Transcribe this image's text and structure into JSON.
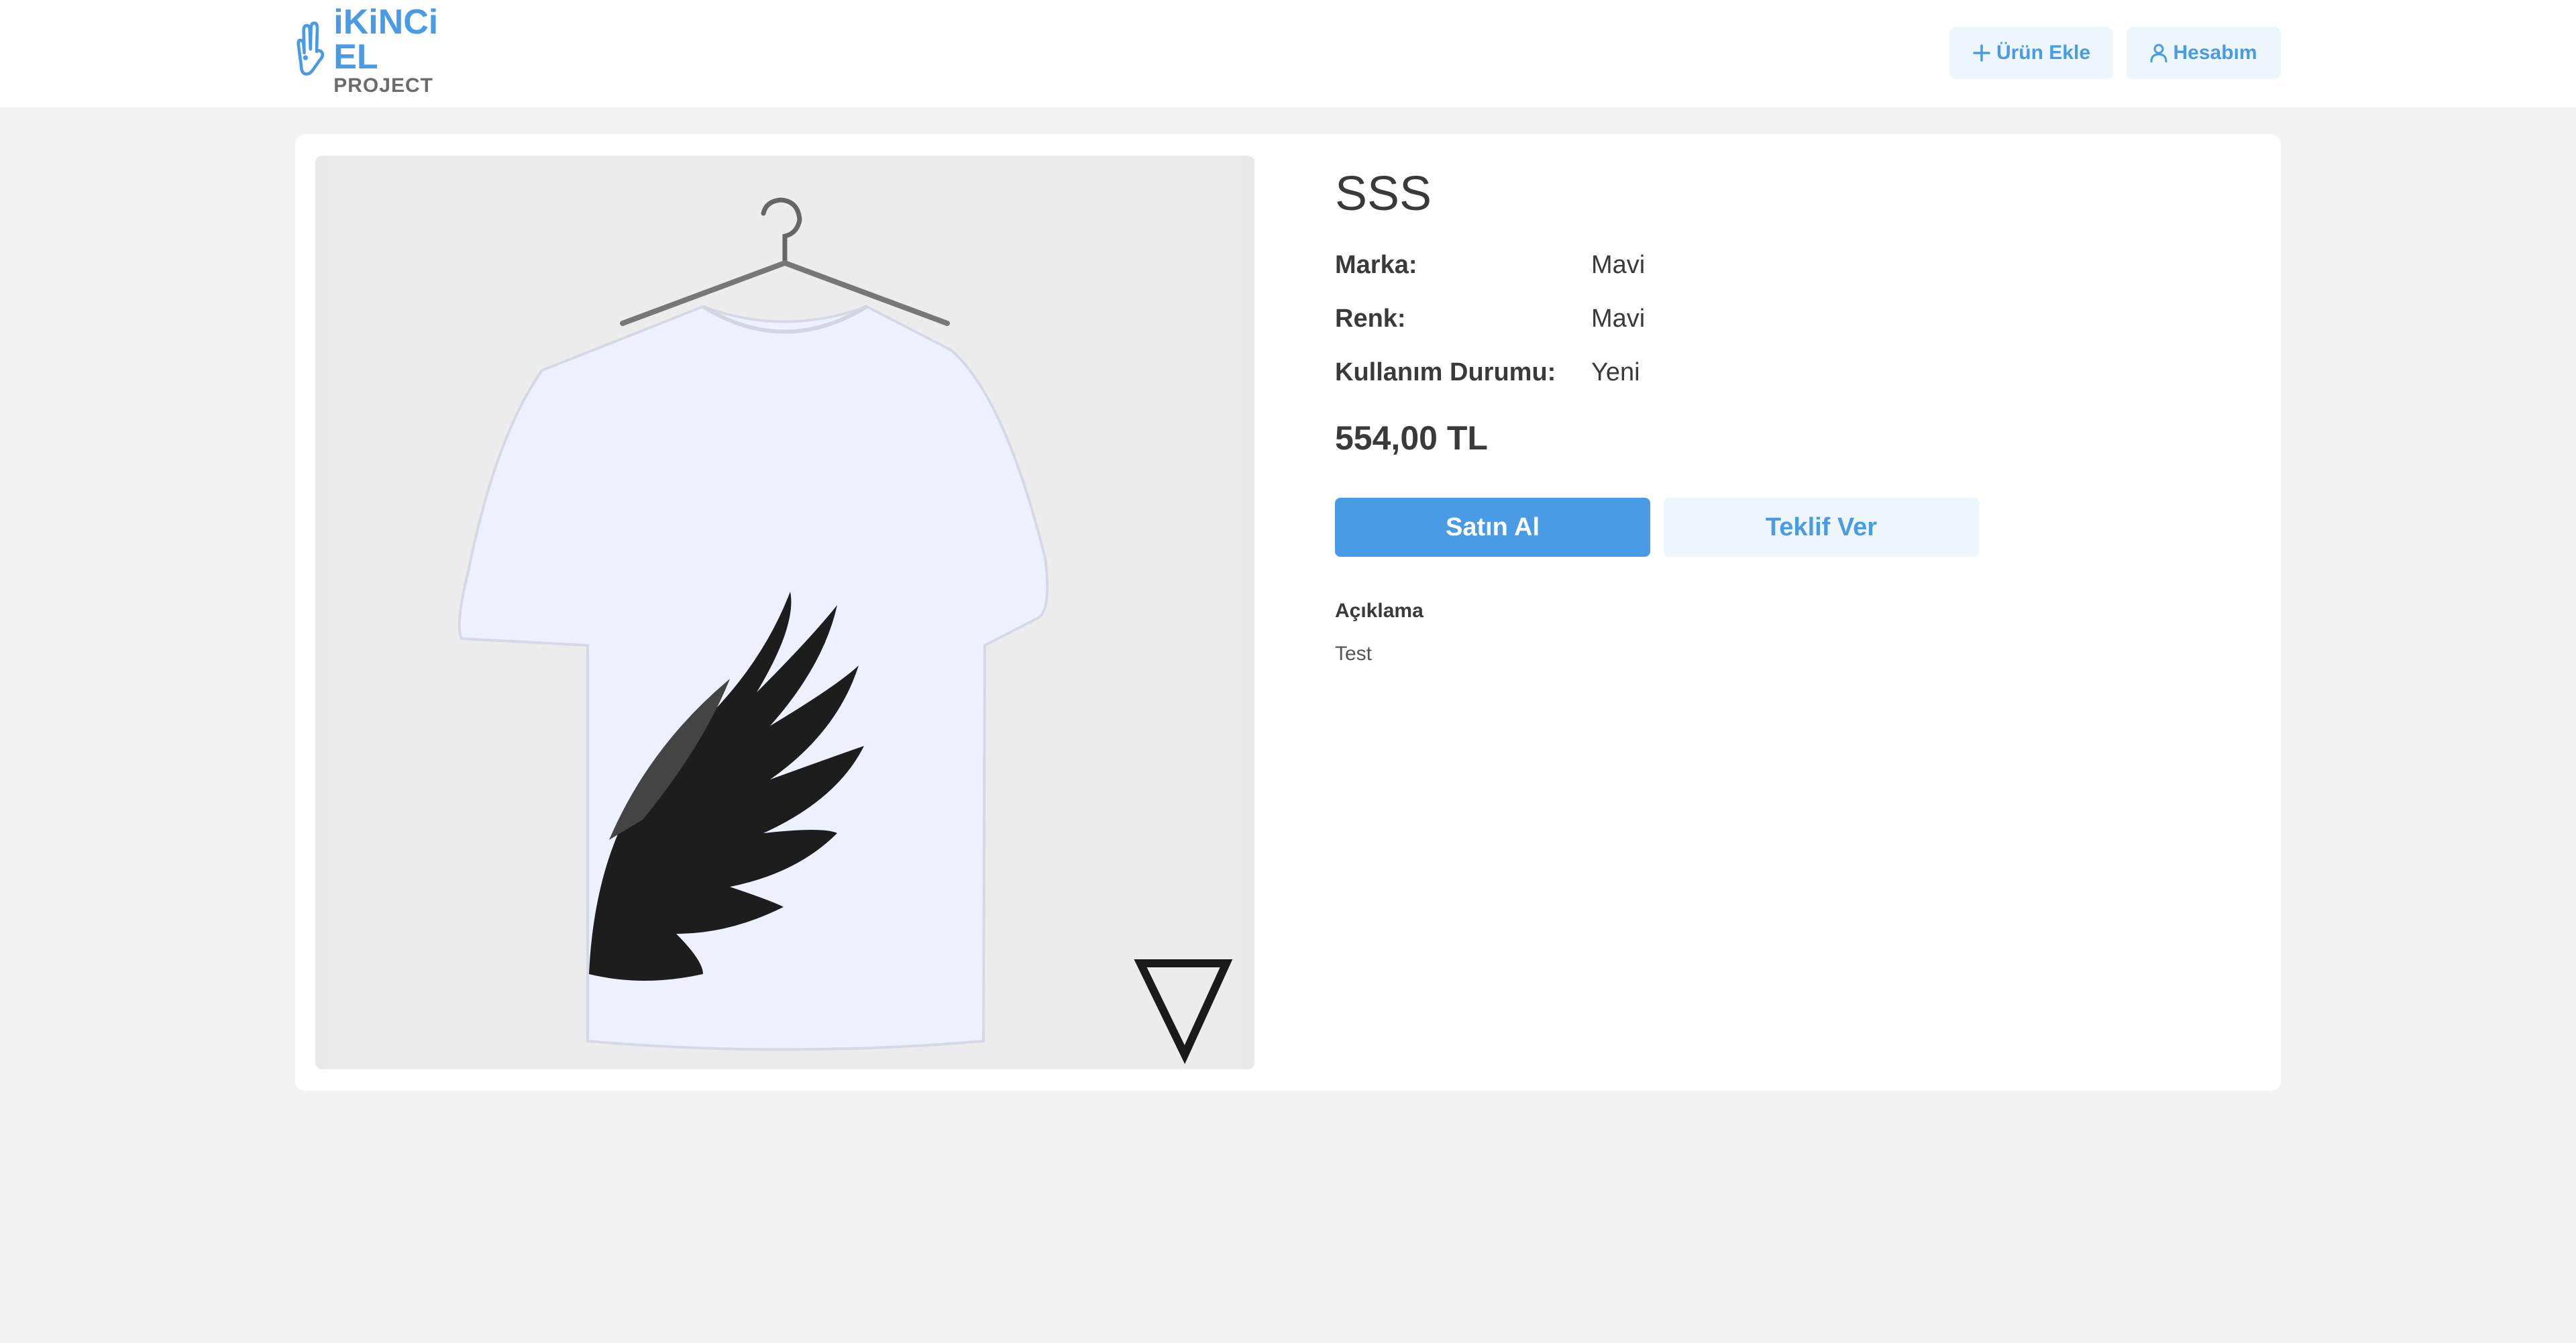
{
  "header": {
    "logo": {
      "main": "iKiNCi EL",
      "sub": "PROJECT"
    },
    "add_product_label": "Ürün Ekle",
    "account_label": "Hesabım"
  },
  "product": {
    "title": "SSS",
    "specs": [
      {
        "label": "Marka:",
        "value": "Mavi"
      },
      {
        "label": "Renk:",
        "value": "Mavi"
      },
      {
        "label": "Kullanım Durumu:",
        "value": "Yeni"
      }
    ],
    "price": "554,00 TL",
    "buy_label": "Satın Al",
    "offer_label": "Teklif Ver",
    "description_title": "Açıklama",
    "description": "Test"
  },
  "colors": {
    "accent": "#4a9be5",
    "accent_light": "#eef6fd",
    "page_bg": "#f2f2f2"
  }
}
